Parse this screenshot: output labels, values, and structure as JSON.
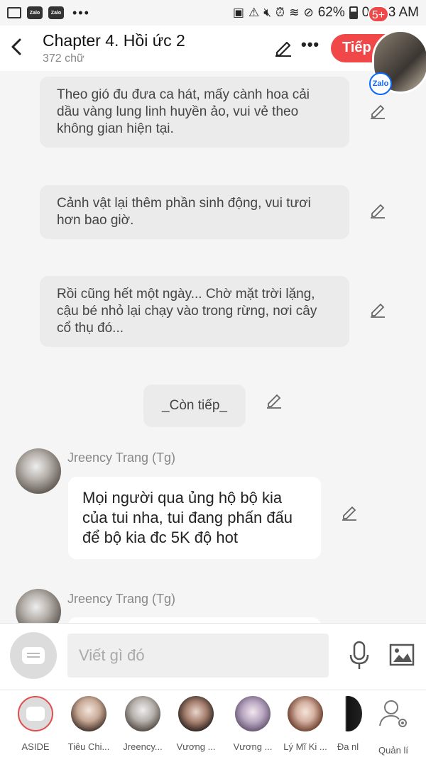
{
  "status_bar": {
    "battery": "62%",
    "time": "08:13 AM",
    "zalo_label": "Zalo",
    "icons": [
      "image-icon",
      "zalo-icon",
      "zalo-icon",
      "more-dots-icon",
      "sim-icon",
      "warning-icon",
      "mute-icon",
      "alarm-icon",
      "wifi-icon",
      "dnd-icon"
    ]
  },
  "header": {
    "title": "Chapter 4. Hồi ức 2",
    "word_count": "372 chữ",
    "next_label": "Tiếp",
    "badge": "5+",
    "zalo_label": "Zalo"
  },
  "narration": [
    "Theo gió đu đưa ca hát, mấy cành hoa cải dầu vàng lung linh huyền ảo, vui vẻ theo không gian hiện tại.",
    "Cảnh vật lại thêm phần sinh động, vui tươi hơn bao giờ.",
    "Rồi cũng hết một ngày... Chờ mặt trời lặng, cậu bé nhỏ lại chạy vào trong rừng, nơi cây cổ thụ đó..."
  ],
  "continued_label": "_Còn tiếp_",
  "messages": [
    {
      "author": "Jreency Trang (Tg)",
      "text": "Mọi người qua ủng hộ bộ kia của tui nha, tui đang phấn đấu để bộ kia đc 5K độ hot"
    },
    {
      "author": "Jreency Trang (Tg)",
      "text": ""
    }
  ],
  "composer": {
    "placeholder": "Viết gì đó"
  },
  "characters": [
    {
      "label": "ASIDE"
    },
    {
      "label": "Tiêu Chi..."
    },
    {
      "label": "Jreency..."
    },
    {
      "label": "Vương ..."
    },
    {
      "label": "Vương ..."
    },
    {
      "label": "Lý Mĩ Ki ..."
    },
    {
      "label": "Đa nl"
    },
    {
      "label": "Quản lí"
    }
  ]
}
